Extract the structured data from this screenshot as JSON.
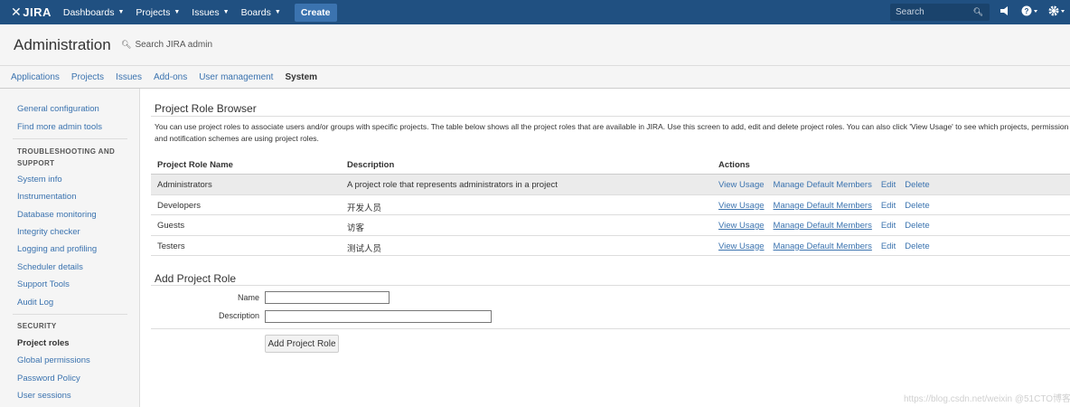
{
  "topnav": {
    "logo": "JIRA",
    "menus": [
      {
        "label": "Dashboards"
      },
      {
        "label": "Projects"
      },
      {
        "label": "Issues"
      },
      {
        "label": "Boards"
      }
    ],
    "create_label": "Create",
    "search_placeholder": "Search",
    "icons": [
      "notification-icon",
      "help-icon",
      "settings-icon"
    ]
  },
  "admin": {
    "title": "Administration",
    "search_placeholder": "Search JIRA admin"
  },
  "tabs": [
    "Applications",
    "Projects",
    "Issues",
    "Add-ons",
    "User management",
    "System"
  ],
  "active_tab": "System",
  "sidebar": {
    "top_links": [
      "General configuration",
      "Find more admin tools"
    ],
    "troubleshooting_heading": "TROUBLESHOOTING AND SUPPORT",
    "troubleshooting_links": [
      "System info",
      "Instrumentation",
      "Database monitoring",
      "Integrity checker",
      "Logging and profiling",
      "Scheduler details",
      "Support Tools",
      "Audit Log"
    ],
    "security_heading": "SECURITY",
    "security_links": [
      "Project roles",
      "Global permissions",
      "Password Policy",
      "User sessions"
    ]
  },
  "main": {
    "title": "Project Role Browser",
    "description_line1": "You can use project roles to associate users and/or groups with specific projects. The table below shows all the project roles that are available in JIRA. Use this screen to add, edit and delete project roles. You can also click 'View Usage' to see which projects, permission sc",
    "description_line2": "and notification schemes are using project roles.",
    "columns": [
      "Project Role Name",
      "Description",
      "Actions"
    ],
    "rows": [
      {
        "name": "Administrators",
        "description": "A project role that represents administrators in a project"
      },
      {
        "name": "Developers",
        "description": "开发人员"
      },
      {
        "name": "Guests",
        "description": "访客"
      },
      {
        "name": "Testers",
        "description": "测试人员"
      }
    ],
    "actions": [
      "View Usage",
      "Manage Default Members",
      "Edit",
      "Delete"
    ],
    "add_title": "Add Project Role",
    "name_label": "Name",
    "description_label": "Description",
    "name_value": "",
    "description_value": "",
    "submit_label": "Add Project Role"
  },
  "watermark": "https://blog.csdn.net/weixin @51CTO博客",
  "colors": {
    "nav_bg": "#205081",
    "create_bg": "#3b73af",
    "link": "#3b73af",
    "highlight_row": "#ebebeb"
  }
}
